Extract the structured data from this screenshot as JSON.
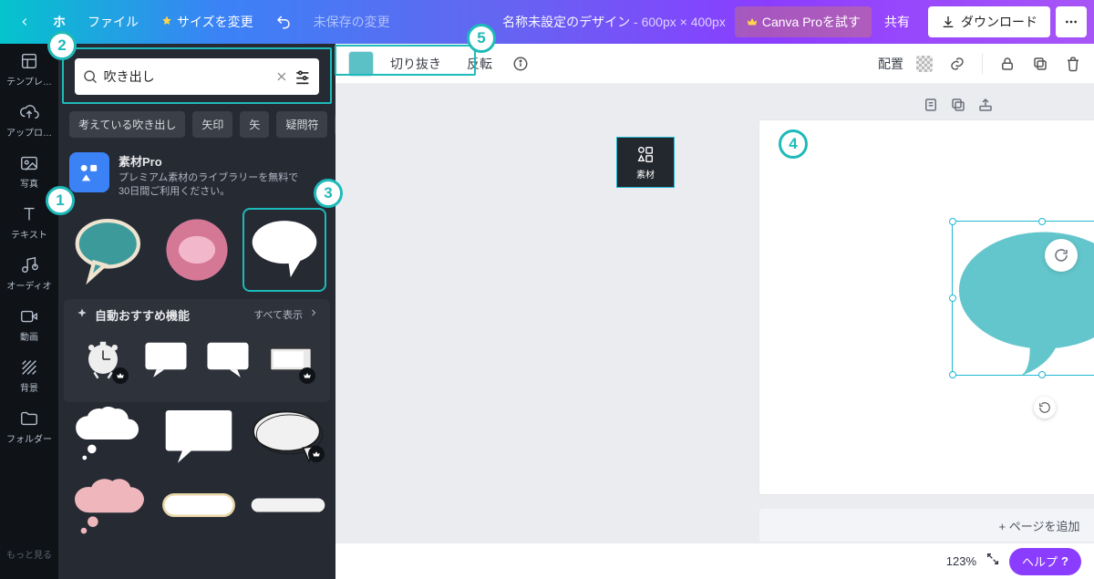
{
  "header": {
    "home": "ホ",
    "file": "ファイル",
    "resize": "サイズを変更",
    "unsaved": "未保存の変更",
    "title_name": "名称未設定のデザイン",
    "title_dim": " - 600px × 400px",
    "try_pro": "Canva Proを試す",
    "share": "共有",
    "download": "ダウンロード"
  },
  "rail": {
    "templates": "テンプレ…",
    "upload": "アップロ…",
    "photo": "写真",
    "elements": "素材",
    "text": "テキスト",
    "audio": "オーディオ",
    "video": "動画",
    "background": "背景",
    "folder": "フォルダー",
    "more": "もっと見る"
  },
  "panel": {
    "search_value": "吹き出し",
    "chips": [
      "考えている吹き出し",
      "矢印",
      "矢",
      "疑問符"
    ],
    "promo_title": "素材Pro",
    "promo_desc1": "プレミアム素材のライブラリーを無料で",
    "promo_desc2": "30日間ご利用ください。",
    "section_title": "自動おすすめ機能",
    "section_all": "すべて表示"
  },
  "toolbar": {
    "crop": "切り抜き",
    "flip": "反転",
    "position": "配置",
    "color": "#5cc1c7"
  },
  "canvas": {
    "add_page": "+ ページを追加"
  },
  "footer": {
    "zoom": "123%",
    "help": "ヘルプ"
  },
  "callouts": {
    "c1": "1",
    "c2": "2",
    "c3": "3",
    "c4": "4",
    "c5": "5"
  }
}
